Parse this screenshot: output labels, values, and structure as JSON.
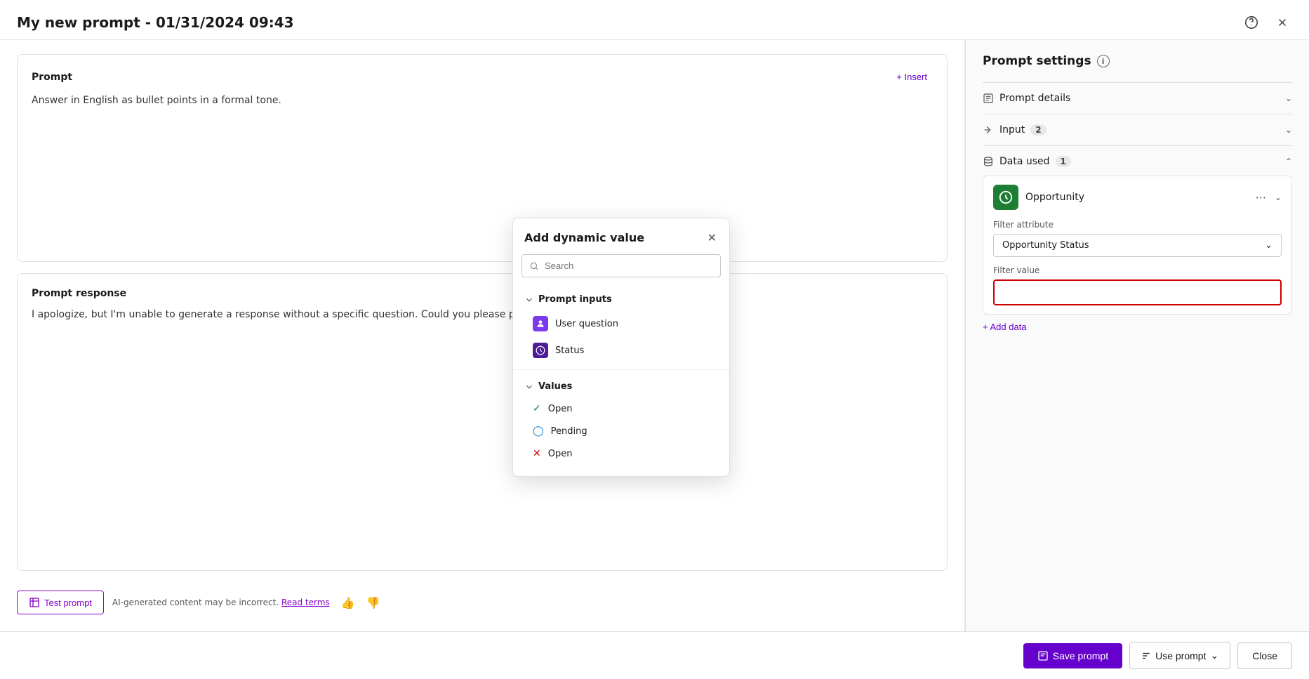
{
  "window": {
    "title": "My new prompt - 01/31/2024 09:43"
  },
  "prompt_card": {
    "label": "Prompt",
    "insert_label": "+ Insert",
    "content": "Answer in English as bullet points in a formal tone."
  },
  "response_card": {
    "label": "Prompt response",
    "content": "I apologize, but I'm unable to generate a response without a specific question. Could you please provide more de..."
  },
  "footer": {
    "test_prompt_label": "Test prompt",
    "ai_notice": "AI-generated content may be incorrect.",
    "read_terms_label": "Read terms"
  },
  "right_panel": {
    "title": "Prompt settings",
    "sections": {
      "prompt_details": {
        "label": "Prompt details"
      },
      "input": {
        "label": "Input",
        "badge": "2"
      },
      "data_used": {
        "label": "Data used",
        "badge": "1"
      }
    },
    "opportunity": {
      "name": "Opportunity",
      "filter_attribute_label": "Filter attribute",
      "filter_attribute_value": "Opportunity Status",
      "filter_value_label": "Filter value",
      "filter_value_placeholder": ""
    },
    "add_data_label": "+ Add data"
  },
  "bottom_bar": {
    "save_label": "Save prompt",
    "use_label": "Use prompt",
    "close_label": "Close"
  },
  "popup": {
    "title": "Add dynamic value",
    "search_placeholder": "Search",
    "prompt_inputs": {
      "label": "Prompt inputs",
      "items": [
        {
          "label": "User question",
          "icon_type": "purple"
        },
        {
          "label": "Status",
          "icon_type": "dark-purple"
        }
      ]
    },
    "values": {
      "label": "Values",
      "items": [
        {
          "label": "Open",
          "icon": "check"
        },
        {
          "label": "Pending",
          "icon": "clock"
        },
        {
          "label": "Open",
          "icon": "x"
        }
      ]
    }
  }
}
